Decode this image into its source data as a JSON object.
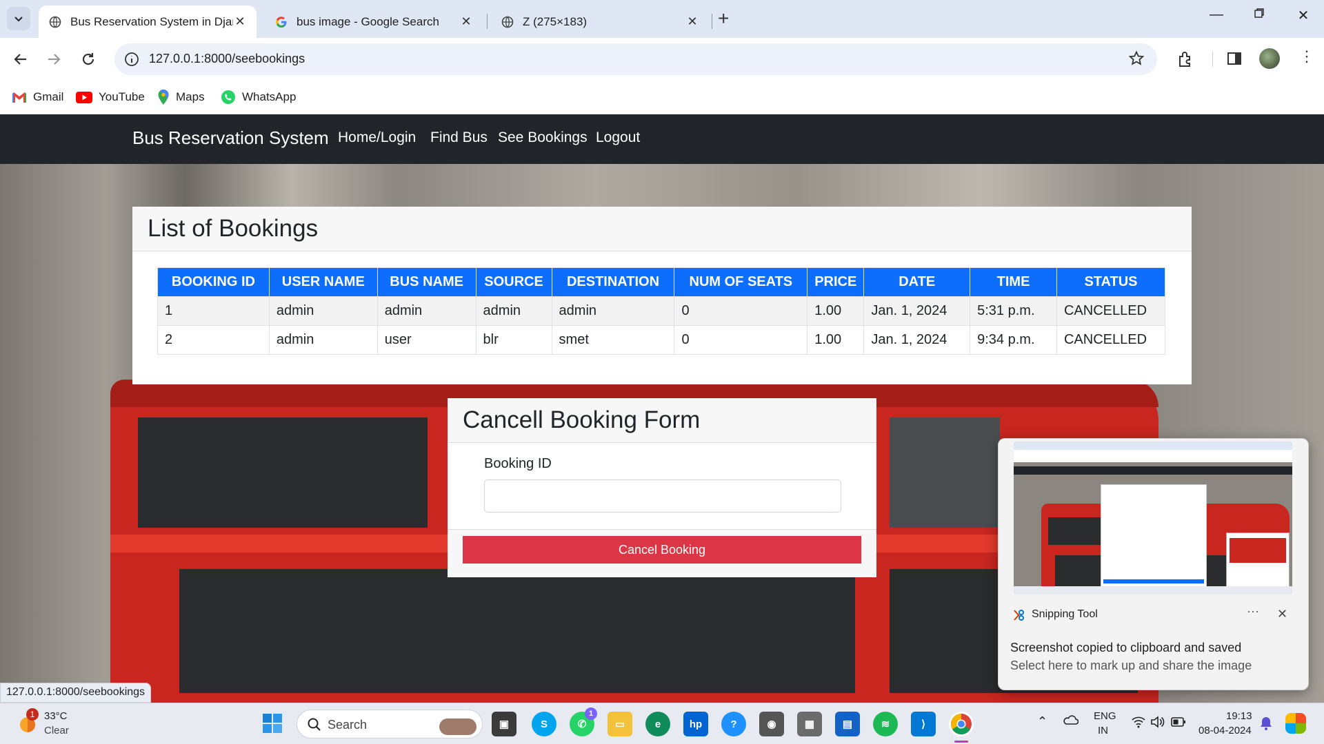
{
  "browser": {
    "tabs": [
      {
        "title": "Bus Reservation System in Djan",
        "active": true
      },
      {
        "title": "bus image - Google Search",
        "active": false
      },
      {
        "title": "Z (275×183)",
        "active": false
      }
    ],
    "url": "127.0.0.1:8000/seebookings",
    "bookmarks": [
      "Gmail",
      "YouTube",
      "Maps",
      "WhatsApp"
    ],
    "status_url": "127.0.0.1:8000/seebookings"
  },
  "navbar": {
    "brand": "Bus Reservation System",
    "links": [
      "Home/Login",
      "Find Bus",
      "See Bookings",
      "Logout"
    ]
  },
  "bookings": {
    "title": "List of Bookings",
    "columns": [
      "BOOKING ID",
      "USER NAME",
      "BUS NAME",
      "SOURCE",
      "DESTINATION",
      "NUM OF SEATS",
      "PRICE",
      "DATE",
      "TIME",
      "STATUS"
    ],
    "rows": [
      [
        "1",
        "admin",
        "admin",
        "admin",
        "admin",
        "0",
        "1.00",
        "Jan. 1, 2024",
        "5:31 p.m.",
        "CANCELLED"
      ],
      [
        "2",
        "admin",
        "user",
        "blr",
        "smet",
        "0",
        "1.00",
        "Jan. 1, 2024",
        "9:34 p.m.",
        "CANCELLED"
      ]
    ]
  },
  "cancel_form": {
    "title": "Cancell Booking Form",
    "label": "Booking ID",
    "value": "",
    "button": "Cancel Booking"
  },
  "toast": {
    "app": "Snipping Tool",
    "title": "Screenshot copied to clipboard and saved",
    "body": "Select here to mark up and share the image"
  },
  "taskbar": {
    "weather_temp": "33°C",
    "weather_desc": "Clear",
    "weather_badge": "1",
    "search_placeholder": "Search",
    "whatsapp_badge": "1",
    "lang": "ENG",
    "region": "IN",
    "time": "19:13",
    "date": "08-04-2024"
  },
  "colors": {
    "navbar": "#212529",
    "table_header": "#0d6efd",
    "danger": "#dc3545"
  }
}
